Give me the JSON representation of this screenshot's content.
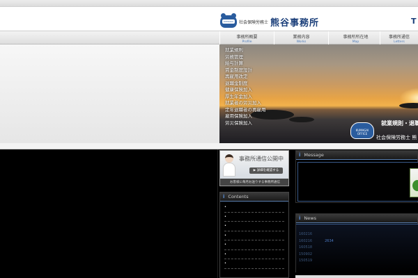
{
  "header": {
    "logo_badge": "KUMAGAI OFFICE",
    "logo_sub": "社会保険労務士",
    "logo_main": "熊谷事務所",
    "right_text": "T"
  },
  "nav": {
    "items": [
      {
        "ja": "事務所概要",
        "en": "Profile"
      },
      {
        "ja": "業務内容",
        "en": "Works"
      },
      {
        "ja": "事務所所在地",
        "en": "Map"
      },
      {
        "ja": "事務所通信",
        "en": "Letters"
      }
    ]
  },
  "hero": {
    "services": [
      "就業規則",
      "労務管理",
      "給与計算",
      "賃金制度設計",
      "再雇用改定",
      "退職金制度",
      "健康保険加入",
      "厚生年金加入",
      "就業者の労災加入",
      "定年退職者の再雇用",
      "雇用保険加入",
      "労災保険加入"
    ],
    "badge": "KUMAGAI OFFICE",
    "tagline1": "就業規則・退職",
    "tagline2": "社会保険労務士 熊"
  },
  "banner": {
    "title": "事務所通信公開中",
    "button": "▶ 詳細を確認する",
    "bottom": "お客様に毎月お送りする事務所通信"
  },
  "contents": {
    "title": "Contents",
    "items": [
      "•",
      "•",
      "•",
      "•",
      "•",
      "•",
      "•"
    ]
  },
  "message": {
    "title": "Message"
  },
  "news": {
    "title": "News",
    "items": [
      {
        "date": "160216",
        "text": ""
      },
      {
        "date": "160216",
        "text": "2634"
      },
      {
        "date": "160518",
        "text": ""
      },
      {
        "date": "150902",
        "text": ""
      },
      {
        "date": "150519",
        "text": ""
      }
    ]
  },
  "colors": {
    "brand": "#1b3f7a",
    "accent": "#2a5c9e",
    "panel_border": "#3a5a8a",
    "background": "#000000"
  }
}
